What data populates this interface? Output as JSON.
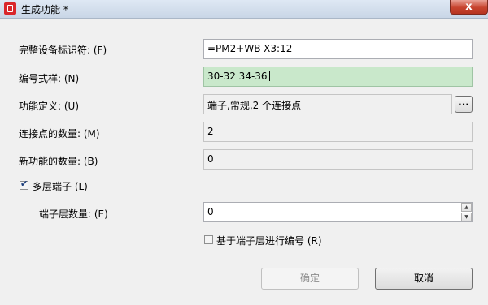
{
  "window": {
    "title": "生成功能 *",
    "close_label": "x"
  },
  "fields": [
    {
      "label": "完整设备标识符: (F)",
      "value": "=PM2+WB-X3:12"
    },
    {
      "label": "编号式样: (N)",
      "value": "30-32 34-36"
    },
    {
      "label": "功能定义: (U)",
      "value": "端子,常规,2 个连接点",
      "browse_label": "..."
    },
    {
      "label": "连接点的数量: (M)",
      "value": "2"
    },
    {
      "label": "新功能的数量: (B)",
      "value": "0"
    }
  ],
  "multilayer": {
    "label": "多层端子 (L)",
    "checked": true
  },
  "layers": {
    "label": "端子层数量: (E)",
    "value": "0"
  },
  "number_by_layer": {
    "label": "基于端子层进行编号 (R)",
    "checked": false
  },
  "buttons": {
    "ok": "确定",
    "cancel": "取消"
  },
  "colors": {
    "highlight": "#c9e8cb",
    "close": "#c7432e"
  }
}
